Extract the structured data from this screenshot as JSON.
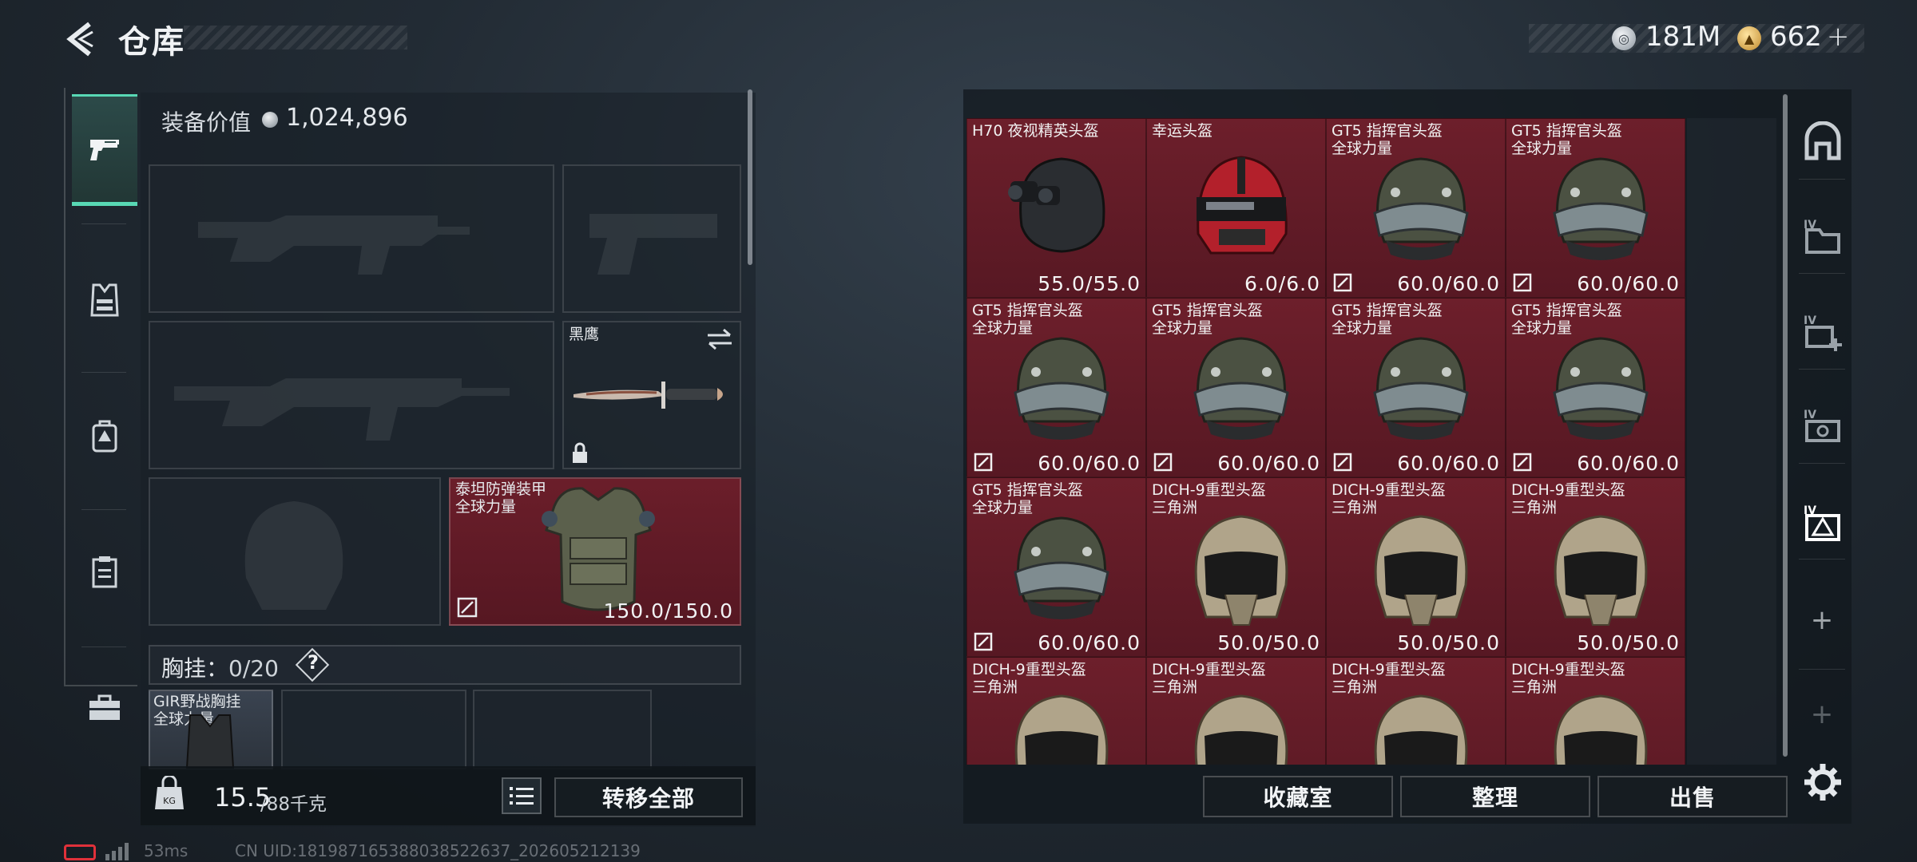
{
  "header": {
    "title": "仓库",
    "currency": [
      {
        "icon": "silver-coin-icon",
        "value": "181M"
      },
      {
        "icon": "gold-coin-icon",
        "value": "662",
        "plus": "+"
      }
    ]
  },
  "rail": {
    "items": [
      {
        "name": "weapons",
        "icon": "pistol-icon",
        "active": true
      },
      {
        "name": "armor",
        "icon": "vest-icon"
      },
      {
        "name": "backpack",
        "icon": "backpack-icon"
      },
      {
        "name": "consumables",
        "icon": "clipboard-icon"
      },
      {
        "name": "toolbox",
        "icon": "toolbox-icon"
      }
    ]
  },
  "equipment": {
    "value_label": "装备价值",
    "value": "1,024,896",
    "slots": {
      "knife": {
        "name": "黑鹰"
      },
      "armor": {
        "name": "泰坦防弹装甲",
        "tag": "全球力量",
        "durability": "150.0/150.0"
      }
    },
    "chest_rig": {
      "label": "胸挂：",
      "count": "0/20",
      "help": "?"
    },
    "chest_item": {
      "name": "GIR野战胸挂",
      "tag": "全球力量"
    }
  },
  "weight": {
    "current": "15.5",
    "max": "/88千克"
  },
  "buttons": {
    "transfer_all": "转移全部",
    "collection": "收藏室",
    "organize": "整理",
    "sell": "出售"
  },
  "storage": {
    "items": [
      {
        "name": "H70 夜视精英头盔",
        "tag": "",
        "durability": "55.0/55.0",
        "art": "nvg",
        "repair": false
      },
      {
        "name": "幸运头盔",
        "tag": "",
        "durability": "6.0/6.0",
        "art": "red",
        "repair": false
      },
      {
        "name": "GT5 指挥官头盔",
        "tag": "全球力量",
        "durability": "60.0/60.0",
        "art": "gt5",
        "repair": true
      },
      {
        "name": "GT5 指挥官头盔",
        "tag": "全球力量",
        "durability": "60.0/60.0",
        "art": "gt5",
        "repair": true
      },
      {
        "name": "GT5 指挥官头盔",
        "tag": "全球力量",
        "durability": "60.0/60.0",
        "art": "gt5",
        "repair": true
      },
      {
        "name": "GT5 指挥官头盔",
        "tag": "全球力量",
        "durability": "60.0/60.0",
        "art": "gt5",
        "repair": true
      },
      {
        "name": "GT5 指挥官头盔",
        "tag": "全球力量",
        "durability": "60.0/60.0",
        "art": "gt5",
        "repair": true
      },
      {
        "name": "GT5 指挥官头盔",
        "tag": "全球力量",
        "durability": "60.0/60.0",
        "art": "gt5",
        "repair": true
      },
      {
        "name": "GT5 指挥官头盔",
        "tag": "全球力量",
        "durability": "60.0/60.0",
        "art": "gt5",
        "repair": true
      },
      {
        "name": "DICH-9重型头盔",
        "tag": "三角洲",
        "durability": "50.0/50.0",
        "art": "dich",
        "repair": false
      },
      {
        "name": "DICH-9重型头盔",
        "tag": "三角洲",
        "durability": "50.0/50.0",
        "art": "dich",
        "repair": false
      },
      {
        "name": "DICH-9重型头盔",
        "tag": "三角洲",
        "durability": "50.0/50.0",
        "art": "dich",
        "repair": false
      },
      {
        "name": "DICH-9重型头盔",
        "tag": "三角洲",
        "durability": "",
        "art": "dich",
        "repair": false
      },
      {
        "name": "DICH-9重型头盔",
        "tag": "三角洲",
        "durability": "",
        "art": "dich",
        "repair": false
      },
      {
        "name": "DICH-9重型头盔",
        "tag": "三角洲",
        "durability": "",
        "art": "dich",
        "repair": false
      },
      {
        "name": "DICH-9重型头盔",
        "tag": "三角洲",
        "durability": "",
        "art": "dich",
        "repair": false
      }
    ]
  },
  "right_rail": {
    "labels": [
      "IV",
      "IV",
      "IV",
      "IV"
    ],
    "plus": "+"
  },
  "status": {
    "ping": "53ms",
    "uid": "CN UID:1819871653880385226​37_202605212139"
  },
  "colors": {
    "accent": "#58d8b4",
    "item_bg": "#6d1f2b",
    "battery": "#e0313a"
  }
}
